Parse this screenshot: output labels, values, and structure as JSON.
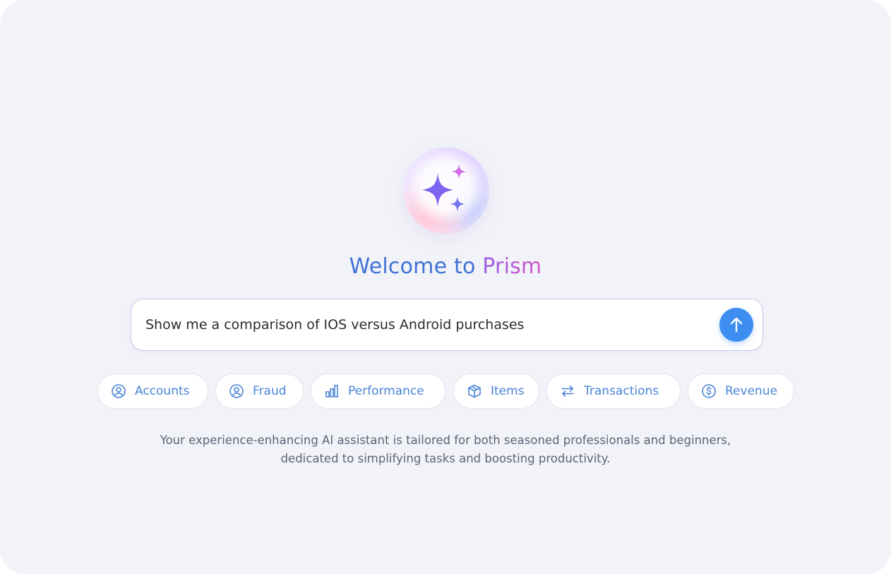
{
  "header": {
    "title_prefix": "Welcome to",
    "title_brand": "Prism"
  },
  "prompt": {
    "value": "Show me a comparison of IOS versus Android purchases",
    "placeholder": ""
  },
  "send_button": {
    "icon": "arrow-up-icon",
    "color": "#3e8ef2"
  },
  "chips": [
    {
      "label": "Accounts",
      "icon": "user-circle-icon"
    },
    {
      "label": "Fraud",
      "icon": "user-circle-icon"
    },
    {
      "label": "Performance",
      "icon": "bar-chart-icon"
    },
    {
      "label": "Items",
      "icon": "box-icon"
    },
    {
      "label": "Transactions",
      "icon": "swap-arrows-icon"
    },
    {
      "label": "Revenue",
      "icon": "dollar-circle-icon"
    }
  ],
  "tagline": {
    "line1": "Your experience-enhancing AI assistant is tailored for both seasoned professionals and beginners,",
    "line2": "dedicated to simplifying tasks and boosting productivity."
  },
  "colors": {
    "background": "#f2f3f8",
    "accent_blue": "#3f72d6",
    "brand_purple": "#9b5de5",
    "chip_text": "#4a84d6"
  }
}
